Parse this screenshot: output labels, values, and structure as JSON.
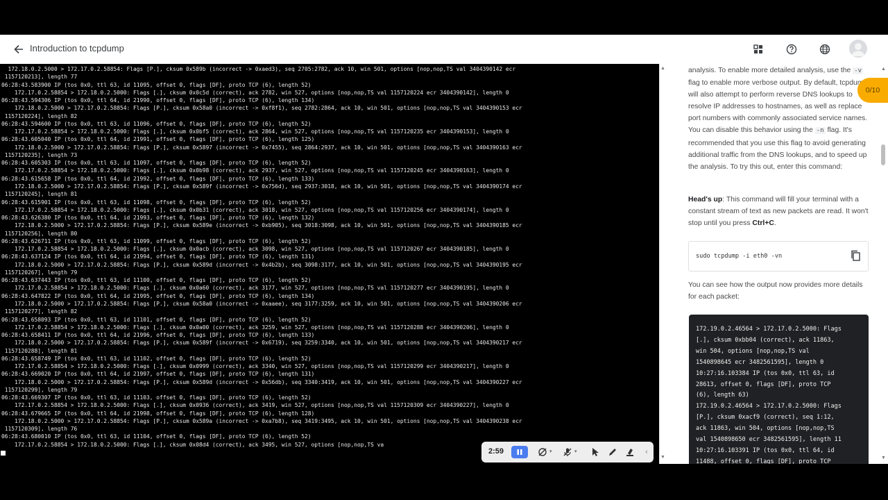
{
  "header": {
    "title": "Introduction to tcpdump",
    "icons": [
      "back-arrow-icon",
      "apps-grid-icon",
      "help-icon",
      "globe-icon",
      "account-avatar"
    ]
  },
  "terminal": {
    "lines": [
      "  172.18.0.2.5000 > 172.17.0.2.58854: Flags [P.], cksum 0x589b (incorrect -> 0xaed3), seq 2705:2782, ack 10, win 501, options [nop,nop,TS val 3404390142 ecr",
      " 1157120213], length 77",
      "06:28:43.583900 IP (tos 0x0, ttl 63, id 11095, offset 0, flags [DF], proto TCP (6), length 52)",
      "    172.17.0.2.58854 > 172.18.0.2.5000: Flags [.], cksum 0x0c5d (correct), ack 2782, win 527, options [nop,nop,TS val 1157120224 ecr 3404390142], length 0",
      "06:28:43.594306 IP (tos 0x0, ttl 64, id 21990, offset 0, flags [DF], proto TCP (6), length 134)",
      "    172.18.0.2.5000 > 172.17.0.2.58854: Flags [P.], cksum 0x58a0 (incorrect -> 0xf8f1), seq 2782:2864, ack 10, win 501, options [nop,nop,TS val 3404390153 ecr",
      " 1157120224], length 82",
      "06:28:43.594600 IP (tos 0x0, ttl 63, id 11096, offset 0, flags [DF], proto TCP (6), length 52)",
      "    172.17.0.2.58854 > 172.18.0.2.5000: Flags [.], cksum 0x0bf5 (correct), ack 2864, win 527, options [nop,nop,TS val 1157120235 ecr 3404390153], length 0",
      "06:28:43.605040 IP (tos 0x0, ttl 64, id 21991, offset 0, flags [DF], proto TCP (6), length 125)",
      "    172.18.0.2.5000 > 172.17.0.2.58854: Flags [P.], cksum 0x5897 (incorrect -> 0x7455), seq 2864:2937, ack 10, win 501, options [nop,nop,TS val 3404390163 ecr",
      " 1157120235], length 73",
      "06:28:43.605303 IP (tos 0x0, ttl 63, id 11097, offset 0, flags [DF], proto TCP (6), length 52)",
      "    172.17.0.2.58854 > 172.18.0.2.5000: Flags [.], cksum 0x0b98 (correct), ack 2937, win 527, options [nop,nop,TS val 1157120245 ecr 3404390163], length 0",
      "06:28:43.615658 IP (tos 0x0, ttl 64, id 21992, offset 0, flags [DF], proto TCP (6), length 133)",
      "    172.18.0.2.5000 > 172.17.0.2.58854: Flags [P.], cksum 0x589f (incorrect -> 0x756d), seq 2937:3018, ack 10, win 501, options [nop,nop,TS val 3404390174 ecr",
      " 1157120245], length 81",
      "06:28:43.615901 IP (tos 0x0, ttl 63, id 11098, offset 0, flags [DF], proto TCP (6), length 52)",
      "    172.17.0.2.58854 > 172.18.0.2.5000: Flags [.], cksum 0x0b31 (correct), ack 3018, win 527, options [nop,nop,TS val 1157120256 ecr 3404390174], length 0",
      "06:28:43.626380 IP (tos 0x0, ttl 64, id 21993, offset 0, flags [DF], proto TCP (6), length 132)",
      "    172.18.0.2.5000 > 172.17.0.2.58854: Flags [P.], cksum 0x589e (incorrect -> 0xb905), seq 3018:3098, ack 10, win 501, options [nop,nop,TS val 3404390185 ecr",
      " 1157120256], length 80",
      "06:28:43.626711 IP (tos 0x0, ttl 63, id 11099, offset 0, flags [DF], proto TCP (6), length 52)",
      "    172.17.0.2.58854 > 172.18.0.2.5000: Flags [.], cksum 0x0acb (correct), ack 3098, win 527, options [nop,nop,TS val 1157120267 ecr 3404390185], length 0",
      "06:28:43.637124 IP (tos 0x0, ttl 64, id 21994, offset 0, flags [DF], proto TCP (6), length 131)",
      "    172.18.0.2.5000 > 172.17.0.2.58854: Flags [P.], cksum 0x589d (incorrect -> 0x4b2b), seq 3098:3177, ack 10, win 501, options [nop,nop,TS val 3404390195 ecr",
      " 1157120267], length 79",
      "06:28:43.637443 IP (tos 0x0, ttl 63, id 11100, offset 0, flags [DF], proto TCP (6), length 52)",
      "    172.17.0.2.58854 > 172.18.0.2.5000: Flags [.], cksum 0x0a60 (correct), ack 3177, win 527, options [nop,nop,TS val 1157120277 ecr 3404390195], length 0",
      "06:28:43.647822 IP (tos 0x0, ttl 64, id 21995, offset 0, flags [DF], proto TCP (6), length 134)",
      "    172.18.0.2.5000 > 172.17.0.2.58854: Flags [P.], cksum 0x58a0 (incorrect -> 0xaaee), seq 3177:3259, ack 10, win 501, options [nop,nop,TS val 3404390206 ecr",
      " 1157120277], length 82",
      "06:28:43.658093 IP (tos 0x0, ttl 63, id 11101, offset 0, flags [DF], proto TCP (6), length 52)",
      "    172.17.0.2.58854 > 172.18.0.2.5000: Flags [.], cksum 0x0a00 (correct), ack 3259, win 527, options [nop,nop,TS val 1157120288 ecr 3404390206], length 0",
      "06:28:43.658411 IP (tos 0x0, ttl 64, id 21996, offset 0, flags [DF], proto TCP (6), length 133)",
      "    172.18.0.2.5000 > 172.17.0.2.58854: Flags [P.], cksum 0x589f (incorrect -> 0x6719), seq 3259:3340, ack 10, win 501, options [nop,nop,TS val 3404390217 ecr",
      " 1157120288], length 81",
      "06:28:43.658749 IP (tos 0x0, ttl 63, id 11102, offset 0, flags [DF], proto TCP (6), length 52)",
      "    172.17.0.2.58854 > 172.18.0.2.5000: Flags [.], cksum 0x0999 (correct), ack 3340, win 527, options [nop,nop,TS val 1157120299 ecr 3404390217], length 0",
      "06:28:43.669020 IP (tos 0x0, ttl 64, id 21997, offset 0, flags [DF], proto TCP (6), length 131)",
      "    172.18.0.2.5000 > 172.17.0.2.58854: Flags [P.], cksum 0x589d (incorrect -> 0x56db), seq 3340:3419, ack 10, win 501, options [nop,nop,TS val 3404390227 ecr",
      " 1157120299], length 79",
      "06:28:43.669307 IP (tos 0x0, ttl 63, id 11103, offset 0, flags [DF], proto TCP (6), length 52)",
      "    172.17.0.2.58854 > 172.18.0.2.5000: Flags [.], cksum 0x0936 (correct), ack 3419, win 527, options [nop,nop,TS val 1157120309 ecr 3404390227], length 0",
      "06:28:43.679665 IP (tos 0x0, ttl 64, id 21998, offset 0, flags [DF], proto TCP (6), length 128)",
      "    172.18.0.2.5000 > 172.17.0.2.58854: Flags [P.], cksum 0x589a (incorrect -> 0xa7b8), seq 3419:3495, ack 10, win 501, options [nop,nop,TS val 3404390238 ecr",
      " 1157120309], length 76",
      "06:28:43.680010 IP (tos 0x0, ttl 63, id 11104, offset 0, flags [DF], proto TCP (6), length 52)",
      "    172.17.0.2.58854 > 172.18.0.2.5000: Flags [.], cksum 0x08d4 (correct), ack 3495, win 527, options [nop,nop,TS va"
    ]
  },
  "panel": {
    "para1_a": "analysis. To enable more detailed analysis, use the ",
    "para1_code1": "-v",
    "para1_b": " flag to enable more verbose output. By default, tcpdump will also attempt to perform reverse DNS lookups to resolve IP addresses to hostnames, as well as replace port numbers with commonly associated service names. You can disable this behavior using the ",
    "para1_code2": "-n",
    "para1_c": " flag. It's recommended that you use this flag to avoid generating additional traffic from the DNS lookups, and to speed up the analysis. To try this out, enter this command:",
    "headsup_label": "Head's up",
    "headsup_text": ": This command will fill your terminal with a constant stream of text as new packets are read. It won't stop until you press ",
    "headsup_key": "Ctrl+C",
    "headsup_end": ".",
    "command": "sudo tcpdump -i eth0 -vn",
    "para2": "You can see how the output now provides more details for each packet:",
    "output": "172.19.0.2.46564 > 172.17.0.2.5000: Flags\n[.], cksum 0xbb04 (correct), ack 11863,\nwin 504, options [nop,nop,TS val\n1540898645 ecr 3482561595], length 0\n10:27:16.103384 IP (tos 0x0, ttl 63, id\n28613, offset 0, flags [DF], proto TCP\n(6), length 63)\n172.19.0.2.46564 > 172.17.0.2.5000: Flags\n[P.], cksum 0xacf9 (correct), seq 1:12,\nack 11863, win 504, options [nop,nop,TS\nval 1540898650 ecr 3482561595], length 11\n10:27:16.103391 IP (tos 0x0, ttl 64, id\n11488, offset 0, flags [DF], proto TCP"
  },
  "progress": {
    "label": "0/10",
    "color": "#f9ab00"
  },
  "toolbar": {
    "timer": "2:59",
    "accent": "#4a7cf0"
  }
}
